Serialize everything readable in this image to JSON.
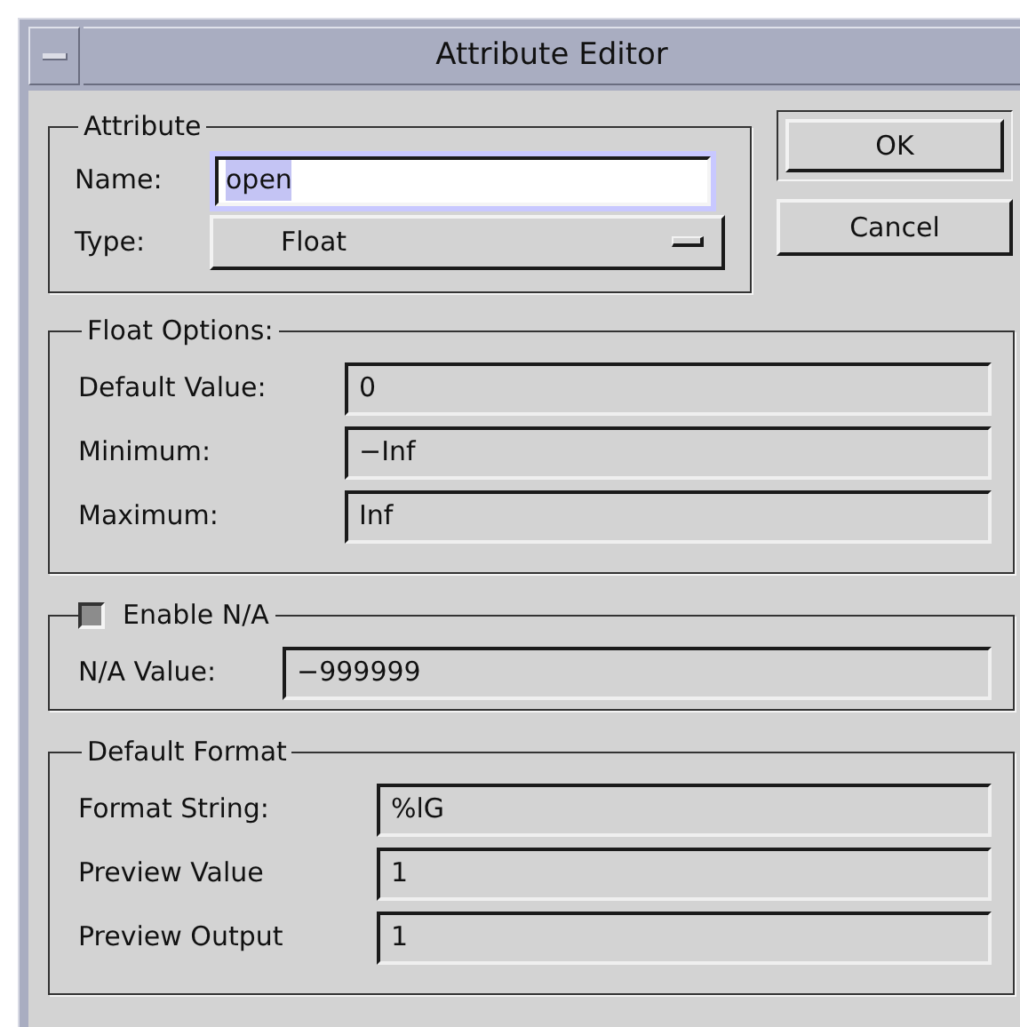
{
  "window": {
    "title": "Attribute Editor"
  },
  "attribute": {
    "legend": "Attribute",
    "name": {
      "label": "Name:",
      "value": "open",
      "focused": true
    },
    "type": {
      "label": "Type:",
      "value": "Float"
    }
  },
  "buttons": [
    {
      "label": "OK",
      "default": true
    },
    {
      "label": "Cancel",
      "default": false
    }
  ],
  "float_options": {
    "legend": "Float Options:",
    "fields": [
      {
        "label": "Default Value:",
        "value": "0"
      },
      {
        "label": "Minimum:",
        "value": "−Inf"
      },
      {
        "label": "Maximum:",
        "value": "Inf"
      }
    ]
  },
  "na": {
    "label": "Enable N/A",
    "checked": true,
    "fields": [
      {
        "label": "N/A Value:",
        "value": "−999999"
      }
    ]
  },
  "format": {
    "legend": "Default Format",
    "fields": [
      {
        "label": "Format String:",
        "value": "%lG"
      },
      {
        "label": "Preview Value",
        "value": "1"
      },
      {
        "label": "Preview Output",
        "value": "1"
      }
    ]
  }
}
